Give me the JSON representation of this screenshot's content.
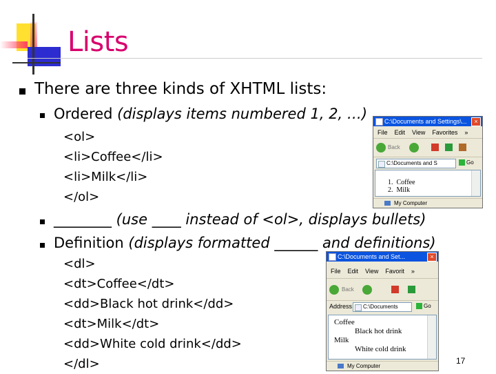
{
  "title": "Lists",
  "bullets": {
    "main": "There are three kinds of XHTML lists:",
    "ordered": {
      "label": "Ordered ",
      "note": "(displays items numbered 1, 2, …)"
    },
    "ordered_code": [
      "<ol>",
      "<li>Coffee</li>",
      "<li>Milk</li>",
      "</ol>"
    ],
    "unordered": {
      "blank": "________",
      "note": " (use ____ instead of <ol>, displays bullets)"
    },
    "definition": {
      "label": "Definition ",
      "note": "(displays formatted ______ and definitions)"
    },
    "definition_code": [
      "<dl>",
      "<dt>Coffee</dt>",
      "<dd>Black hot drink</dd>",
      "<dt>Milk</dt>",
      "<dd>White cold drink</dd>",
      "</dl>"
    ]
  },
  "browser1": {
    "title": "C:\\Documents and Settings\\...",
    "menu": [
      "File",
      "Edit",
      "View",
      "Favorites",
      "»"
    ],
    "back_label": "Back",
    "address_value": "C:\\Documents and S",
    "go_label": "Go",
    "items": [
      {
        "num": "1.",
        "text": "Coffee"
      },
      {
        "num": "2.",
        "text": "Milk"
      }
    ],
    "status": "My Computer"
  },
  "browser2": {
    "title": "C:\\Documents and Set...",
    "menu": [
      "File",
      "Edit",
      "View",
      "Favorit",
      "»"
    ],
    "back_label": "Back",
    "address_label": "Address",
    "address_value": "C:\\Documents",
    "go_label": "Go",
    "terms": [
      {
        "term": "Coffee",
        "def": "Black hot drink"
      },
      {
        "term": "Milk",
        "def": "White cold drink"
      }
    ],
    "status": "My Computer"
  },
  "page_number": "17",
  "colors": {
    "title": "#d8006c",
    "deco_yellow": "#ffe030",
    "deco_blue": "#2c2cd0",
    "deco_red": "#ff4060"
  }
}
